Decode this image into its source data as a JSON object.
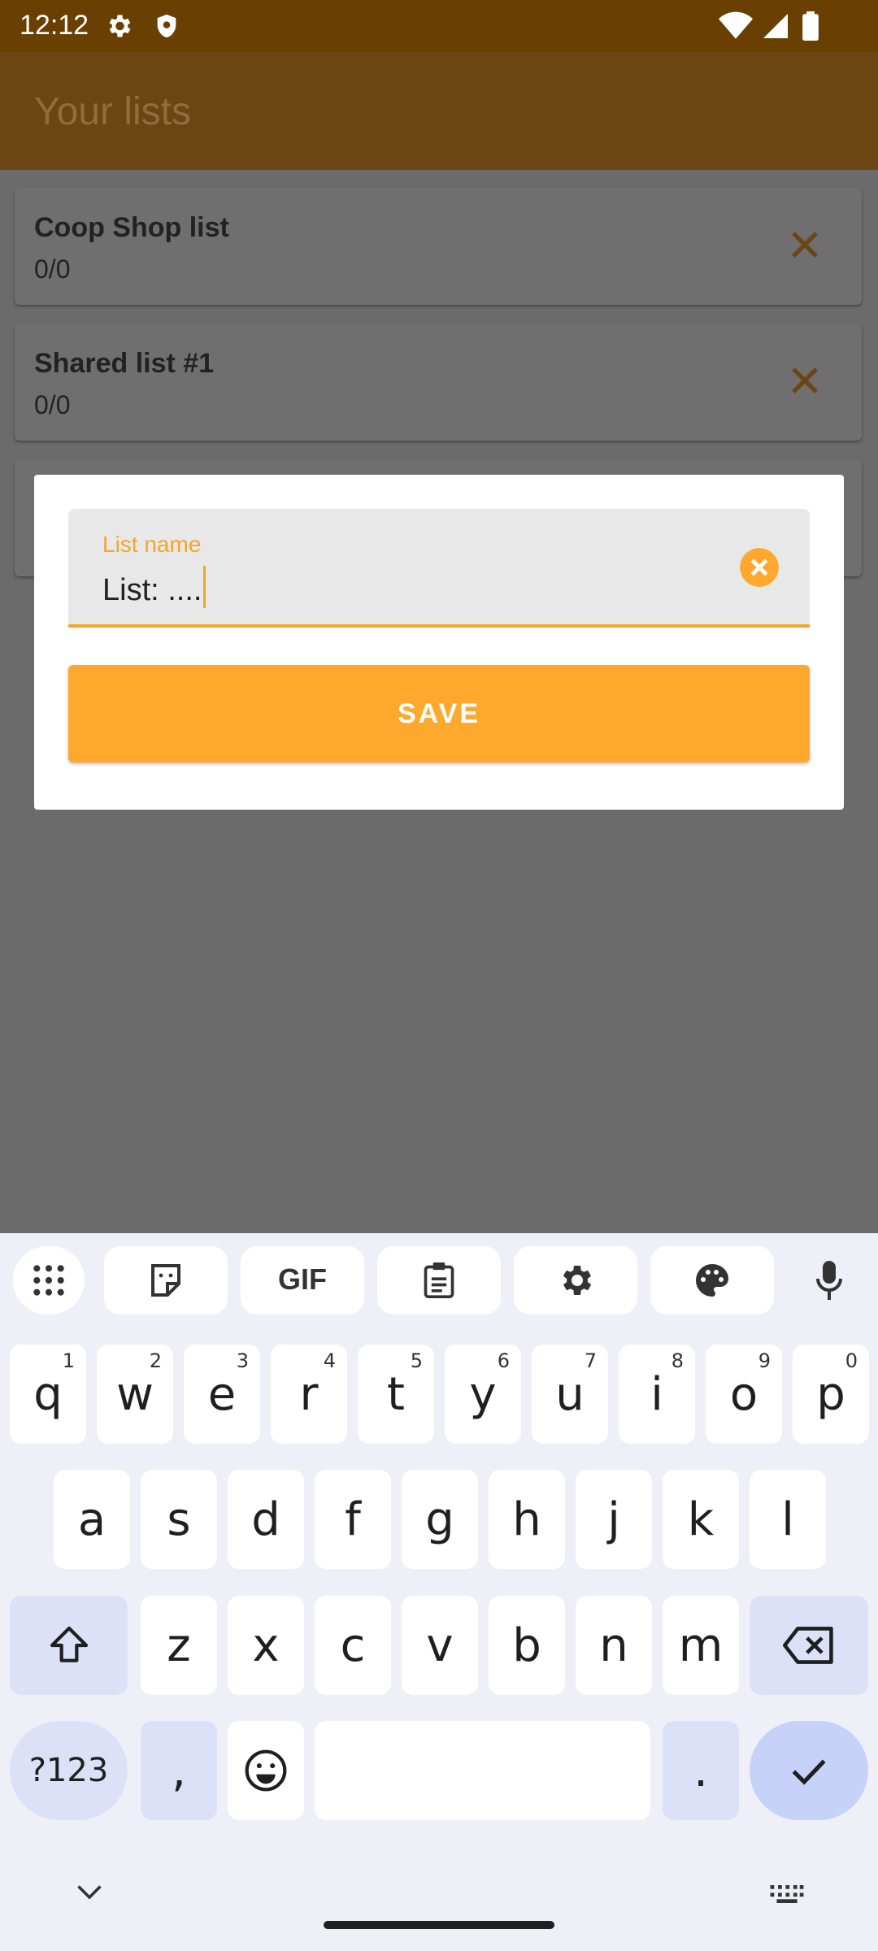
{
  "status_bar": {
    "time": "12:12"
  },
  "app_bar": {
    "title": "Your lists"
  },
  "lists": [
    {
      "name": "Coop Shop list",
      "count": "0/0"
    },
    {
      "name": "Shared list #1",
      "count": "0/0"
    }
  ],
  "dialog": {
    "field_label": "List name",
    "field_value": "List: ....",
    "save_label": "SAVE"
  },
  "colors": {
    "accent": "#ffa82e",
    "app_bar": "#6b4513",
    "status_bar": "#6a4002"
  },
  "keyboard": {
    "toolbar_icons": [
      "apps-grid-icon",
      "sticker-icon",
      "gif-icon",
      "clipboard-icon",
      "gear-icon",
      "palette-icon",
      "microphone-icon"
    ],
    "gif_label": "GIF",
    "row1": [
      "q",
      "w",
      "e",
      "r",
      "t",
      "y",
      "u",
      "i",
      "o",
      "p"
    ],
    "row1_hints": [
      "1",
      "2",
      "3",
      "4",
      "5",
      "6",
      "7",
      "8",
      "9",
      "0"
    ],
    "row2": [
      "a",
      "s",
      "d",
      "f",
      "g",
      "h",
      "j",
      "k",
      "l"
    ],
    "row3": [
      "z",
      "x",
      "c",
      "v",
      "b",
      "n",
      "m"
    ],
    "symbols_label": "?123",
    "comma": ",",
    "period": "."
  }
}
